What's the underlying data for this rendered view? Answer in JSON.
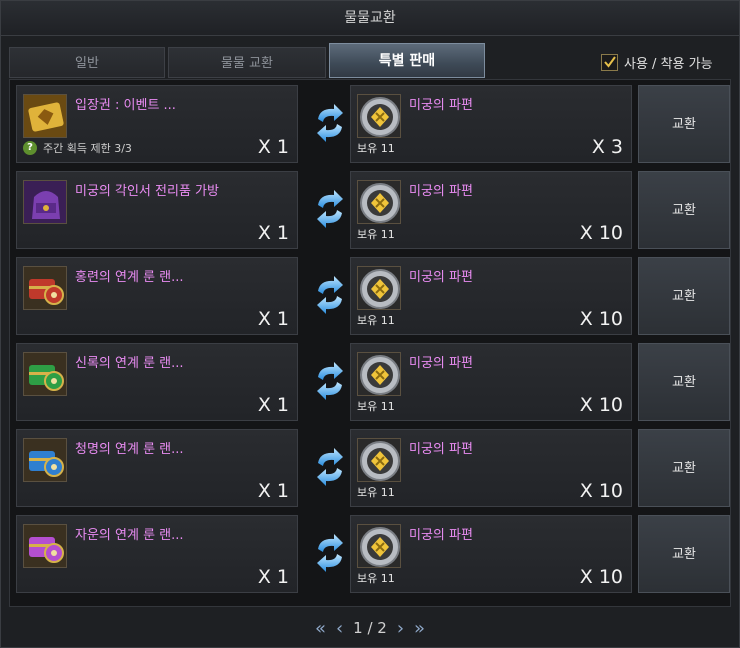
{
  "window": {
    "title": "물물교환"
  },
  "tabs": [
    {
      "label": "일반"
    },
    {
      "label": "물물 교환"
    },
    {
      "label": "특별 판매"
    }
  ],
  "filter": {
    "label": "사용 / 착용 가능",
    "checked": true
  },
  "rows": [
    {
      "give_name": "입장권 : 이벤트 ...",
      "give_icon": "ticket-icon",
      "give_qty": "X 1",
      "limit_text": "주간 획득 제한 3/3",
      "get_name": "미궁의 파편",
      "get_icon": "labyrinth-fragment-icon",
      "own_text": "보유 11",
      "get_qty": "X 3",
      "button": "교환"
    },
    {
      "give_name": "미궁의 각인서 전리품 가방",
      "give_icon": "bag-icon",
      "give_qty": "X 1",
      "limit_text": "",
      "get_name": "미궁의 파편",
      "get_icon": "labyrinth-fragment-icon",
      "own_text": "보유 11",
      "get_qty": "X 10",
      "button": "교환"
    },
    {
      "give_name": "홍련의 연계 룬 랜...",
      "give_icon": "red-chest-icon",
      "give_qty": "X 1",
      "limit_text": "",
      "get_name": "미궁의 파편",
      "get_icon": "labyrinth-fragment-icon",
      "own_text": "보유 11",
      "get_qty": "X 10",
      "button": "교환"
    },
    {
      "give_name": "신록의 연계 룬 랜...",
      "give_icon": "green-chest-icon",
      "give_qty": "X 1",
      "limit_text": "",
      "get_name": "미궁의 파편",
      "get_icon": "labyrinth-fragment-icon",
      "own_text": "보유 11",
      "get_qty": "X 10",
      "button": "교환"
    },
    {
      "give_name": "청명의 연계 룬 랜...",
      "give_icon": "blue-chest-icon",
      "give_qty": "X 1",
      "limit_text": "",
      "get_name": "미궁의 파편",
      "get_icon": "labyrinth-fragment-icon",
      "own_text": "보유 11",
      "get_qty": "X 10",
      "button": "교환"
    },
    {
      "give_name": "자운의 연계 룬 랜...",
      "give_icon": "purple-chest-icon",
      "give_qty": "X 1",
      "limit_text": "",
      "get_name": "미궁의 파편",
      "get_icon": "labyrinth-fragment-icon",
      "own_text": "보유 11",
      "get_qty": "X 10",
      "button": "교환"
    }
  ],
  "pager": {
    "text": "1 / 2"
  },
  "colors": {
    "item_name": "#e98cf2",
    "chest_colors": [
      "#c0392b",
      "#2e9e45",
      "#2f7fd0",
      "#b44fd0"
    ]
  }
}
